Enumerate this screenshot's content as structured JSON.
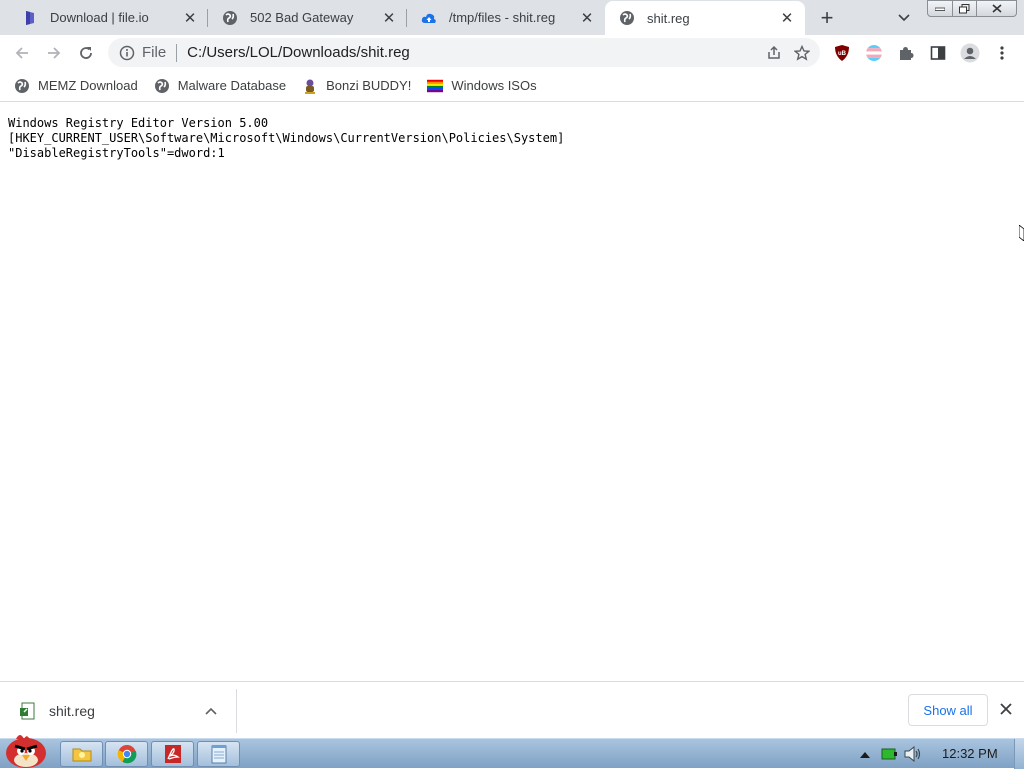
{
  "tabs": [
    {
      "title": "Download | file.io",
      "icon": "file-io-icon",
      "active": false
    },
    {
      "title": "502 Bad Gateway",
      "icon": "globe-icon",
      "active": false
    },
    {
      "title": "/tmp/files - shit.reg",
      "icon": "cloud-upload-icon",
      "active": false
    },
    {
      "title": "shit.reg",
      "icon": "globe-icon",
      "active": true
    }
  ],
  "toolbar": {
    "scheme": "File",
    "url": "C:/Users/LOL/Downloads/shit.reg"
  },
  "bookmarks": [
    {
      "label": "MEMZ Download",
      "icon": "globe-icon"
    },
    {
      "label": "Malware Database",
      "icon": "globe-icon"
    },
    {
      "label": "Bonzi BUDDY!",
      "icon": "bonzi-icon"
    },
    {
      "label": "Windows ISOs",
      "icon": "rainbow-flag-icon"
    }
  ],
  "content": {
    "lines": [
      "Windows Registry Editor Version 5.00",
      "[HKEY_CURRENT_USER\\Software\\Microsoft\\Windows\\CurrentVersion\\Policies\\System]",
      "\"DisableRegistryTools\"=dword:1"
    ]
  },
  "download": {
    "filename": "shit.reg",
    "show_all_label": "Show all"
  },
  "taskbar": {
    "clock": "12:32 PM"
  },
  "colors": {
    "tabstrip_bg": "#dee1e6",
    "accent_blue": "#1a73e8",
    "ublock_red": "#800000"
  }
}
